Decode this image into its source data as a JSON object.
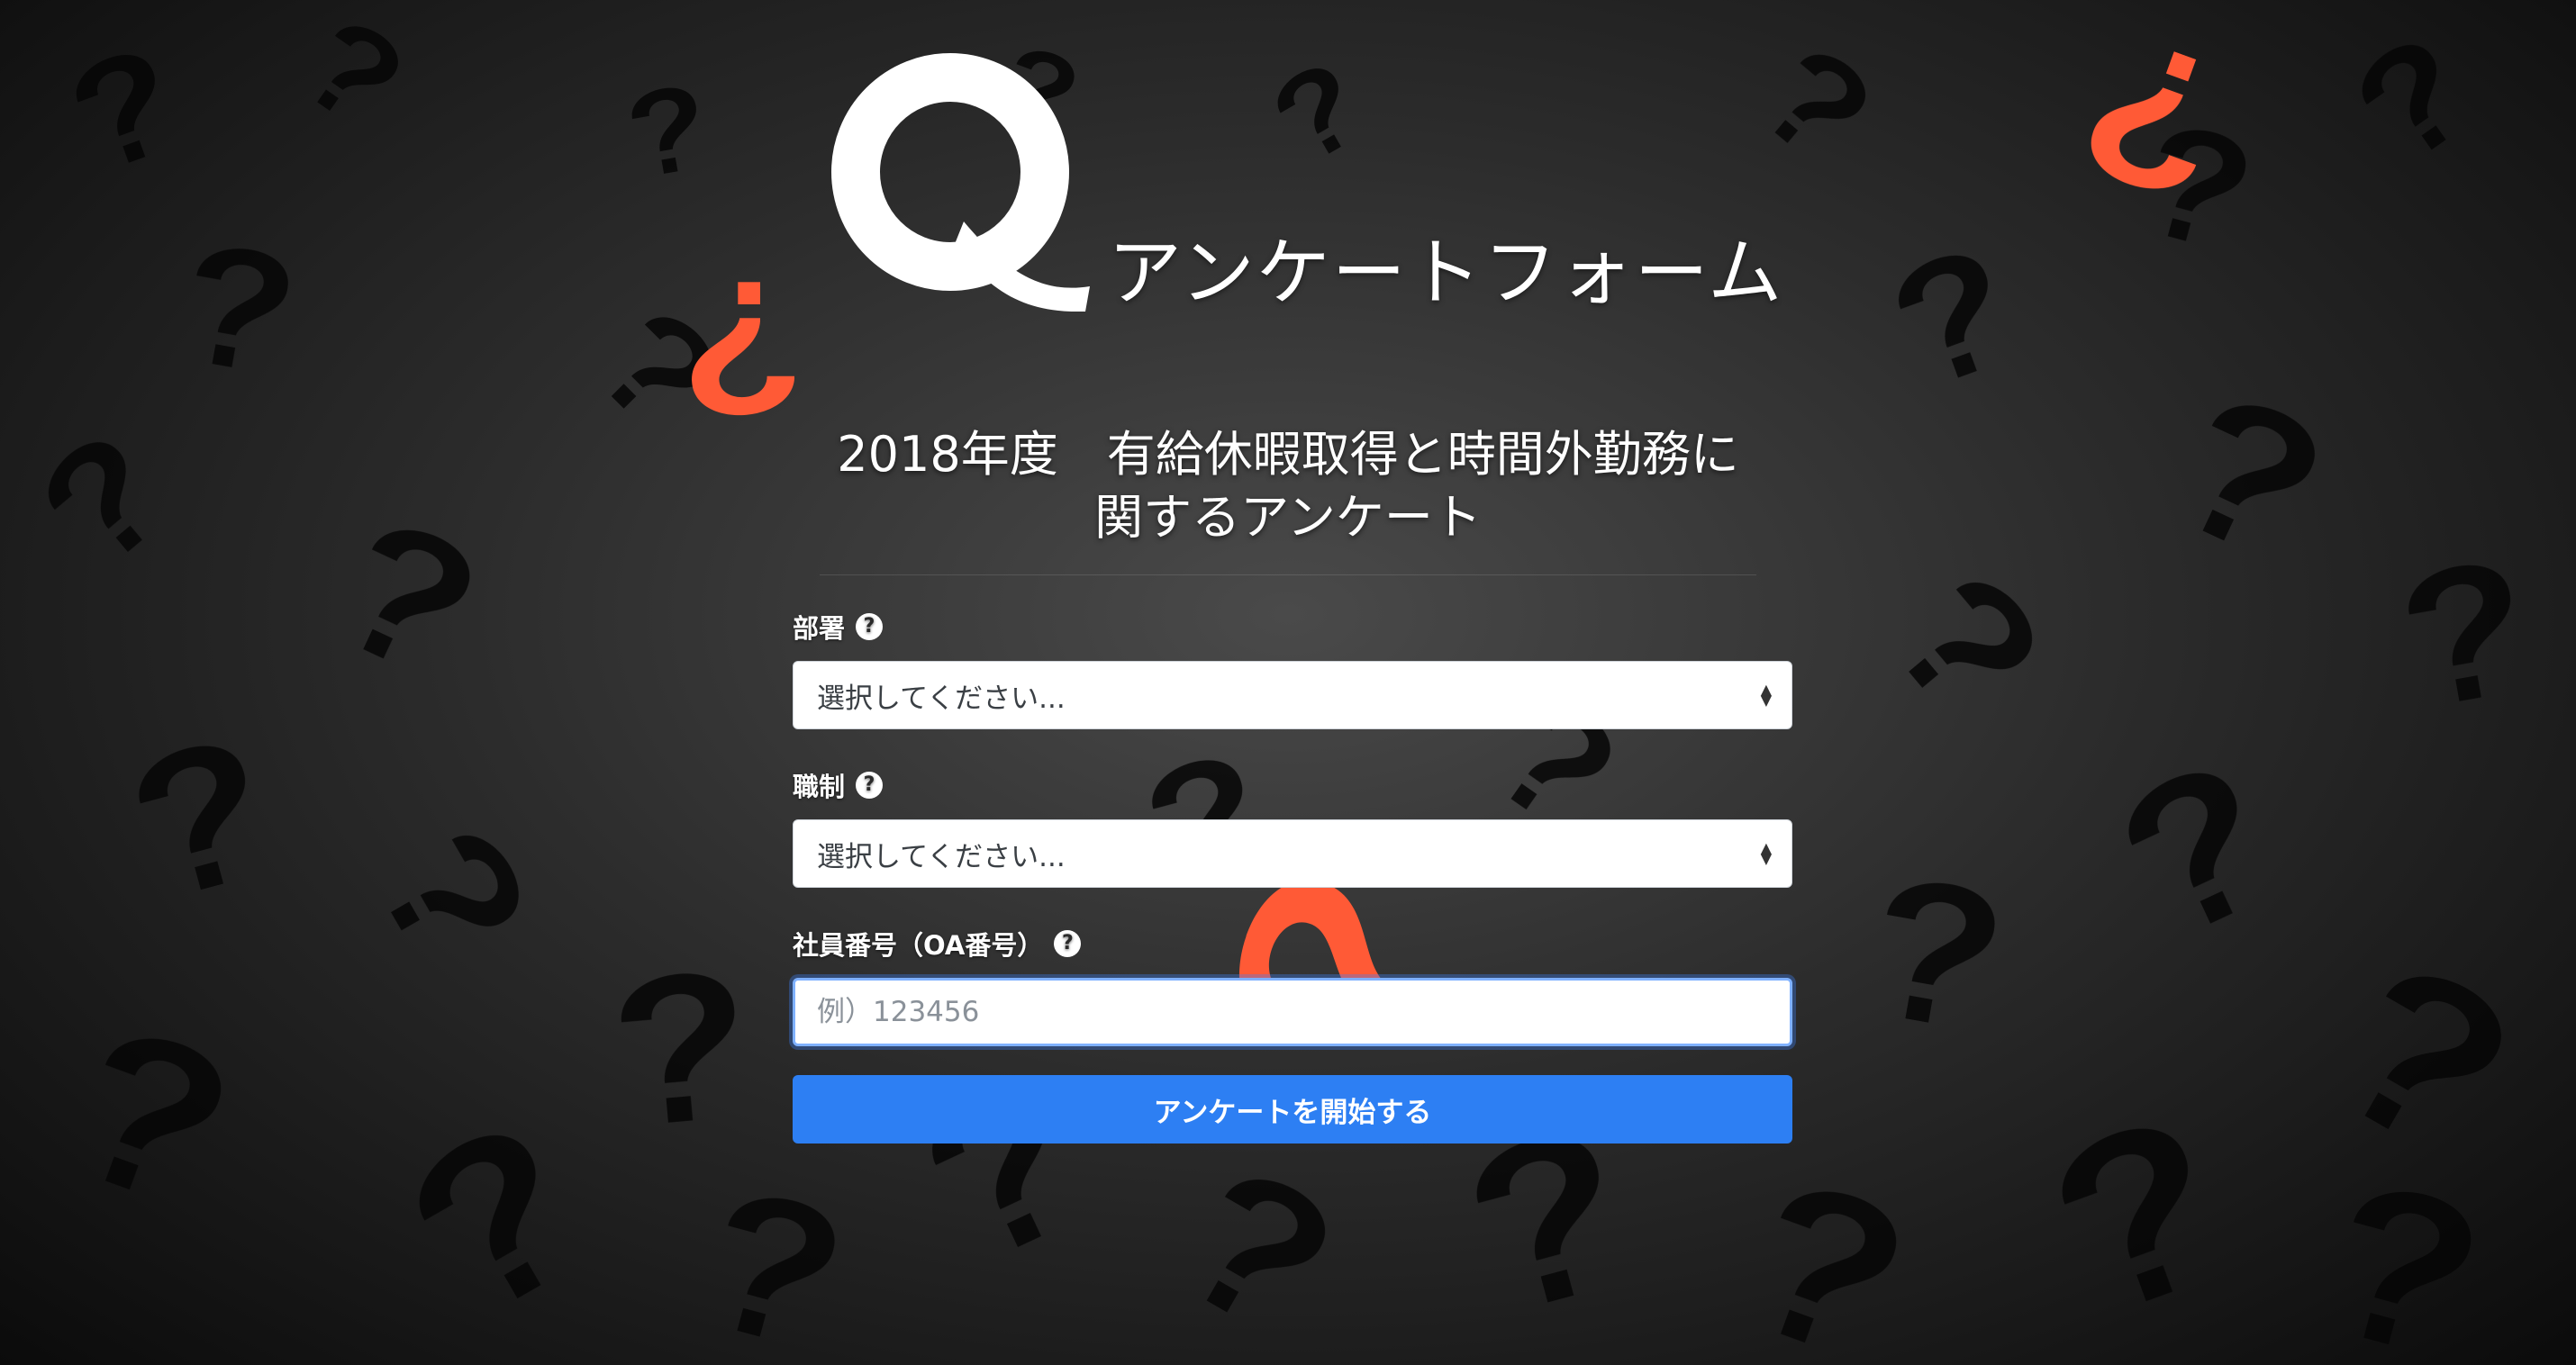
{
  "logo": {
    "mark": "Q",
    "text": "アンケートフォーム"
  },
  "title": {
    "line1": "2018年度　有給休暇取得と時間外勤務に",
    "line2": "関するアンケート"
  },
  "form": {
    "department": {
      "label": "部署",
      "help_icon": "question-circle-icon",
      "selected": "選択してください..."
    },
    "position": {
      "label": "職制",
      "help_icon": "question-circle-icon",
      "selected": "選択してください..."
    },
    "employee_id": {
      "label": "社員番号（OA番号）",
      "help_icon": "question-circle-icon",
      "placeholder": "例）123456",
      "value": ""
    },
    "submit_label": "アンケートを開始する"
  },
  "colors": {
    "accent": "#2d7ff3",
    "background": "#2c2c2c",
    "highlight_question_mark": "#ff5a36"
  }
}
